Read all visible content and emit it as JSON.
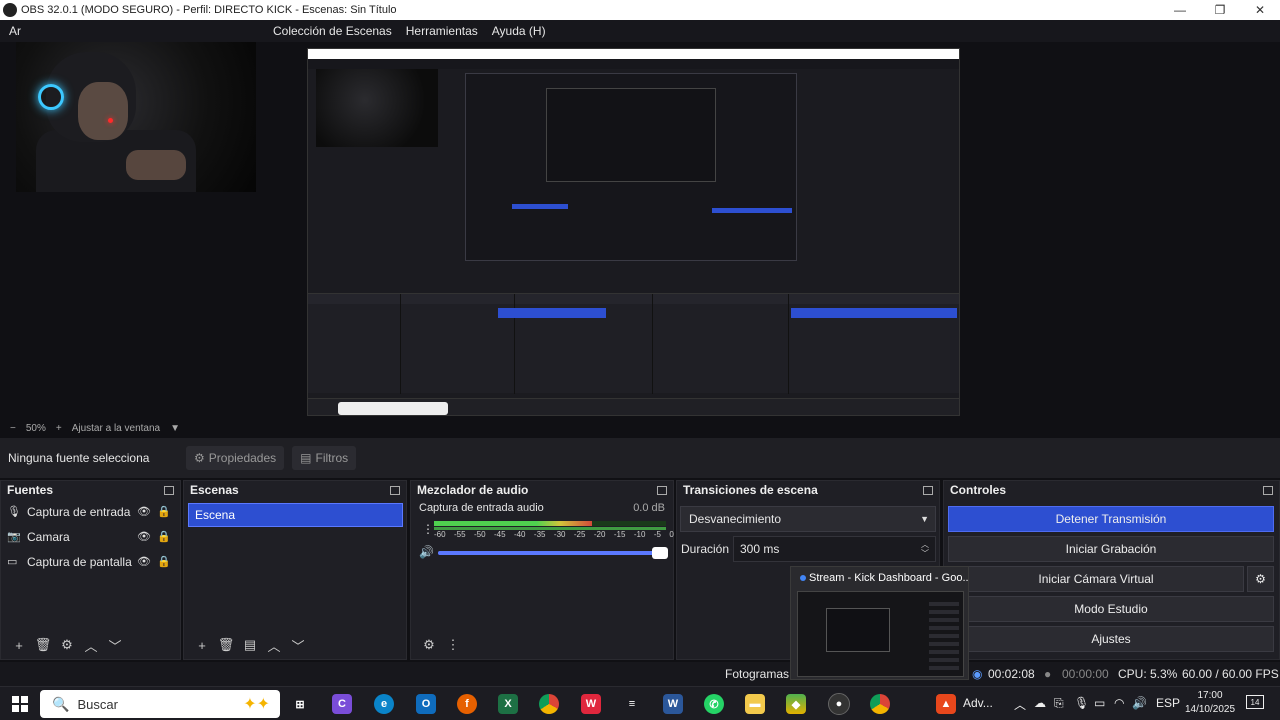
{
  "window": {
    "title": "OBS 32.0.1 (MODO SEGURO) - Perfil: DIRECTO KICK - Escenas: Sin Título",
    "minimize": "—",
    "maximize": "❐",
    "close": "✕"
  },
  "menu": {
    "first": "Ar",
    "items": [
      "Colección de Escenas",
      "Herramientas",
      "Ayuda (H)"
    ]
  },
  "zoom": {
    "minus": "−",
    "value": "50%",
    "plus": "+",
    "fit": "Ajustar a la ventana",
    "dropdown": "▼"
  },
  "sourcebar": {
    "no_source": "Ninguna fuente selecciona",
    "properties": "Propiedades",
    "filters": "Filtros"
  },
  "docks": {
    "sources": {
      "title": "Fuentes",
      "items": [
        {
          "label": "Captura de entrada de audio",
          "icon": "microphone-icon"
        },
        {
          "label": "Camara",
          "icon": "camera-icon"
        },
        {
          "label": "Captura de pantalla",
          "icon": "monitor-icon"
        }
      ]
    },
    "scenes": {
      "title": "Escenas",
      "items": [
        "Escena"
      ]
    },
    "mixer": {
      "title": "Mezclador de audio",
      "channel": "Captura de entrada audio",
      "db": "0.0 dB",
      "ticks": [
        "-60",
        "-55",
        "-50",
        "-45",
        "-40",
        "-35",
        "-30",
        "-25",
        "-20",
        "-15",
        "-10",
        "-5",
        "0"
      ],
      "volume_level": 1.0
    },
    "transitions": {
      "title": "Transiciones de escena",
      "selected": "Desvanecimiento",
      "duration_label": "Duración",
      "duration_value": "300 ms"
    },
    "controls": {
      "title": "Controles",
      "buttons": [
        "Detener Transmisión",
        "Iniciar Grabación",
        "Iniciar Cámara Virtual",
        "Modo Estudio",
        "Ajustes"
      ]
    }
  },
  "popup": {
    "title": "Stream - Kick Dashboard - Goo..."
  },
  "status": {
    "frames": "Fotogramas I",
    "live_time": "00:02:08",
    "rec_time": "00:00:00",
    "cpu": "CPU: 5.3%",
    "fps": "60.00 / 60.00 FPS"
  },
  "taskbar": {
    "search": "Buscar",
    "adv": "Adv...",
    "lang": "ESP",
    "time": "17:00",
    "date": "14/10/2025",
    "notif_count": "14"
  },
  "colors": {
    "accent": "#2d4fd1",
    "panel": "#1f1f25",
    "background": "#101014"
  }
}
